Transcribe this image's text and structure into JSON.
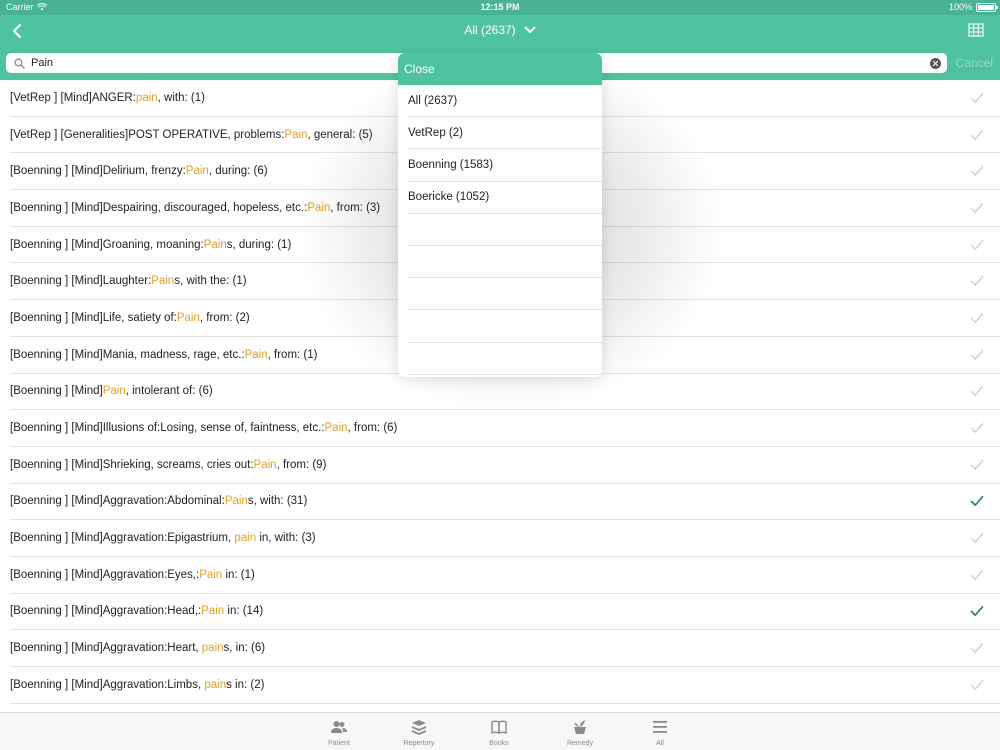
{
  "status_bar": {
    "carrier": "Carrier",
    "time": "12:15 PM",
    "battery": "100%",
    "battery_level": 1.0
  },
  "nav": {
    "title": "All (2637)"
  },
  "search": {
    "value": "Pain",
    "cancel_label": "Cancel"
  },
  "colors": {
    "accent": "#4fc3a1",
    "status": "#47b394",
    "highlight": "#e1a12a",
    "check_on": "#2e8b67",
    "check_off": "#c9c9c9"
  },
  "results": [
    {
      "pre": "[VetRep ] [Mind]ANGER:",
      "hl": "pain",
      "post": ", with: (1)",
      "checked": false
    },
    {
      "pre": "[VetRep ] [Generalities]POST OPERATIVE, problems:",
      "hl": "Pain",
      "post": ", general: (5)",
      "checked": false
    },
    {
      "pre": "[Boenning ] [Mind]Delirium, frenzy:",
      "hl": "Pain",
      "post": ", during: (6)",
      "checked": false
    },
    {
      "pre": "[Boenning ] [Mind]Despairing, discouraged, hopeless, etc.:",
      "hl": "Pain",
      "post": ", from: (3)",
      "checked": false
    },
    {
      "pre": "[Boenning ] [Mind]Groaning, moaning:",
      "hl": "Pain",
      "post": "s, during: (1)",
      "checked": false
    },
    {
      "pre": "[Boenning ] [Mind]Laughter:",
      "hl": "Pain",
      "post": "s, with the: (1)",
      "checked": false
    },
    {
      "pre": "[Boenning ] [Mind]Life, satiety of:",
      "hl": "Pain",
      "post": ", from: (2)",
      "checked": false
    },
    {
      "pre": "[Boenning ] [Mind]Mania, madness, rage, etc.:",
      "hl": "Pain",
      "post": ", from: (1)",
      "checked": false
    },
    {
      "pre": "[Boenning ] [Mind]",
      "hl": "Pain",
      "post": ", intolerant of: (6)",
      "checked": false
    },
    {
      "pre": "[Boenning ] [Mind]Illusions of:Losing, sense of, faintness, etc.:",
      "hl": "Pain",
      "post": ", from: (6)",
      "checked": false
    },
    {
      "pre": "[Boenning ] [Mind]Shrieking, screams, cries out:",
      "hl": "Pain",
      "post": ", from: (9)",
      "checked": false
    },
    {
      "pre": "[Boenning ] [Mind]Aggravation:Abdominal:",
      "hl": "Pain",
      "post": "s, with: (31)",
      "checked": true
    },
    {
      "pre": "[Boenning ] [Mind]Aggravation:Epigastrium, ",
      "hl": "pain",
      "post": " in, with: (3)",
      "checked": false
    },
    {
      "pre": "[Boenning ] [Mind]Aggravation:Eyes,:",
      "hl": "Pain",
      "post": " in: (1)",
      "checked": false
    },
    {
      "pre": "[Boenning ] [Mind]Aggravation:Head,:",
      "hl": "Pain",
      "post": " in: (14)",
      "checked": true
    },
    {
      "pre": "[Boenning ] [Mind]Aggravation:Heart, ",
      "hl": "pain",
      "post": "s, in: (6)",
      "checked": false
    },
    {
      "pre": "[Boenning ] [Mind]Aggravation:Limbs, ",
      "hl": "pain",
      "post": "s in: (2)",
      "checked": false
    }
  ],
  "popover": {
    "close_label": "Close",
    "items": [
      "All (2637)",
      "VetRep (2)",
      "Boenning (1583)",
      "Boericke (1052)",
      "",
      "",
      "",
      "",
      ""
    ]
  },
  "tabs": [
    {
      "label": "Patient",
      "icon": "patient-icon"
    },
    {
      "label": "Repertory",
      "icon": "repertory-icon"
    },
    {
      "label": "Books",
      "icon": "books-icon"
    },
    {
      "label": "Remedy",
      "icon": "remedy-icon"
    },
    {
      "label": "All",
      "icon": "menu-icon"
    }
  ]
}
